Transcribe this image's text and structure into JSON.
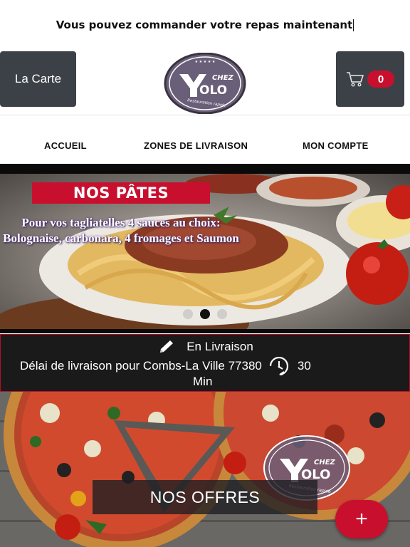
{
  "announcement": "Vous pouvez commander votre repas maintenant",
  "header": {
    "menu_button": "La Carte",
    "cart_count": "0",
    "logo": {
      "chez": "CHEZ",
      "name": "OLO",
      "tagline": "Restauration rapide"
    }
  },
  "nav": {
    "items": [
      "ACCUEIL",
      "ZONES DE LIVRAISON",
      "MON COMPTE"
    ]
  },
  "slider": {
    "banner": "NOS PÂTES",
    "text_line1": "Pour vos tagliatelles 4 sauces au choix:",
    "text_line2": "Bolognaise, carbonara, 4 fromages et Saumon",
    "active_slide": 2,
    "slide_count": 3
  },
  "delivery": {
    "mode": "En Livraison",
    "delay_text": "Délai de livraison pour Combs-La Ville 77380",
    "delay_value": "30",
    "delay_unit": "Min"
  },
  "promo": {
    "label": "NOS OFFRES",
    "fab_symbol": "+"
  },
  "colors": {
    "accent_red": "#c8102e",
    "button_dark": "#3c4147",
    "delivery_bg": "#1a1a1a"
  }
}
